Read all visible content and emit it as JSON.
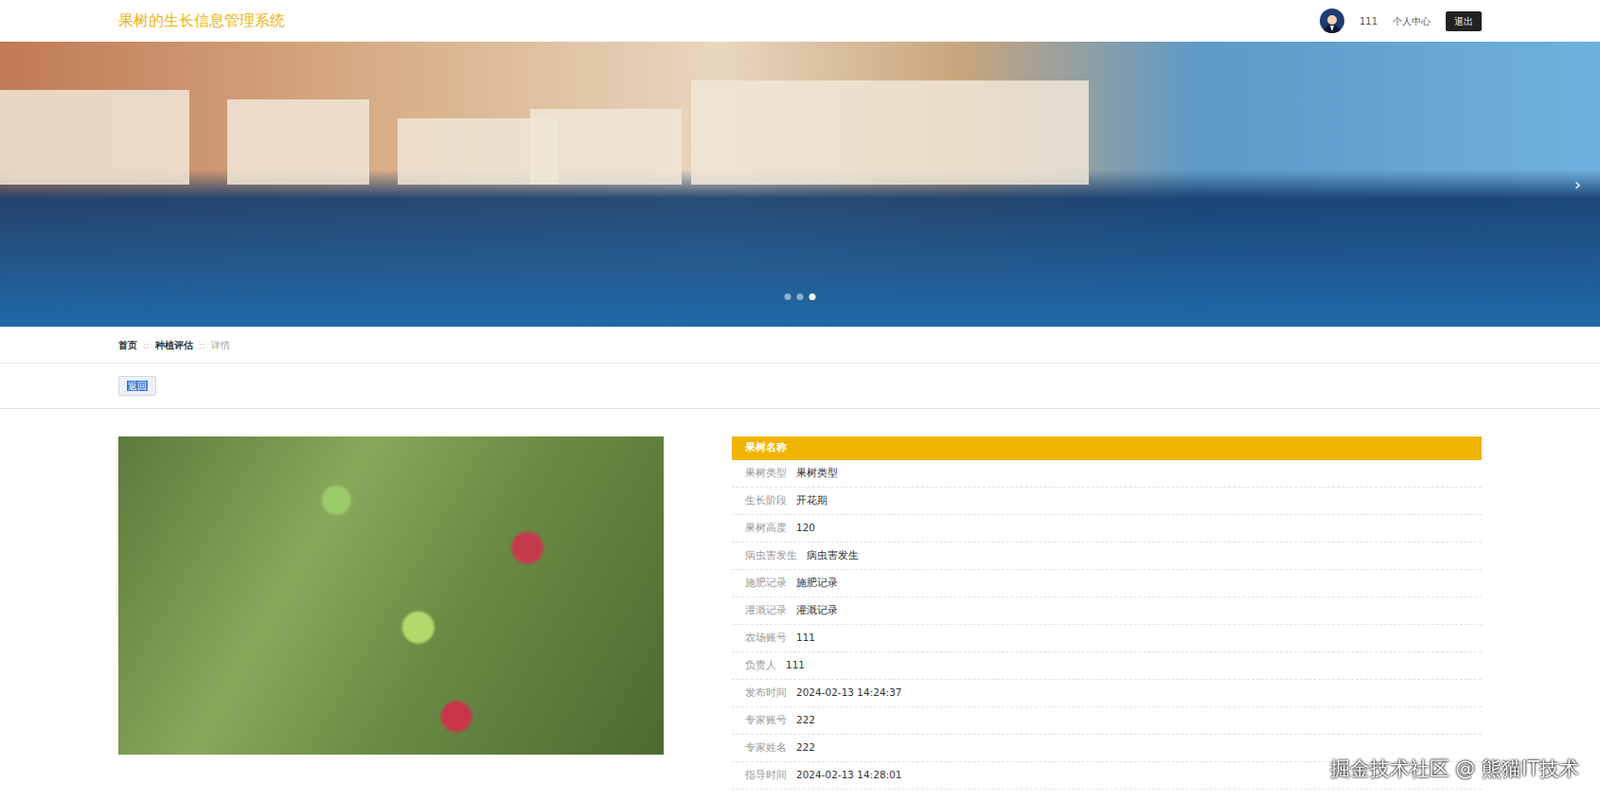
{
  "header": {
    "title": "果树的生长信息管理系统",
    "username": "111",
    "profile": "个人中心",
    "logout": "退出"
  },
  "banner": {
    "slides": [
      {
        "selected": false
      },
      {
        "selected": false
      },
      {
        "selected": true
      }
    ],
    "next": "›"
  },
  "breadcrumb": {
    "separator": "::",
    "items": [
      {
        "label": "首页",
        "current": false
      },
      {
        "label": "种植评估",
        "current": false
      },
      {
        "label": "详情",
        "current": true
      }
    ]
  },
  "back_button": {
    "label": "返回"
  },
  "detail": {
    "title": "果树名称",
    "fields": [
      {
        "label": "果树类型",
        "value": "果树类型"
      },
      {
        "label": "生长阶段",
        "value": "开花期"
      },
      {
        "label": "果树高度",
        "value": "120"
      },
      {
        "label": "病虫害发生",
        "value": "病虫害发生"
      },
      {
        "label": "施肥记录",
        "value": "施肥记录"
      },
      {
        "label": "灌溉记录",
        "value": "灌溉记录"
      },
      {
        "label": "农场账号",
        "value": "111"
      },
      {
        "label": "负责人",
        "value": "111"
      },
      {
        "label": "发布时间",
        "value": "2024-02-13 14:24:37"
      },
      {
        "label": "专家账号",
        "value": "222"
      },
      {
        "label": "专家姓名",
        "value": "222"
      },
      {
        "label": "指导时间",
        "value": "2024-02-13 14:28:01"
      }
    ]
  },
  "watermark": "掘金技术社区 @ 熊猫IT技术"
}
